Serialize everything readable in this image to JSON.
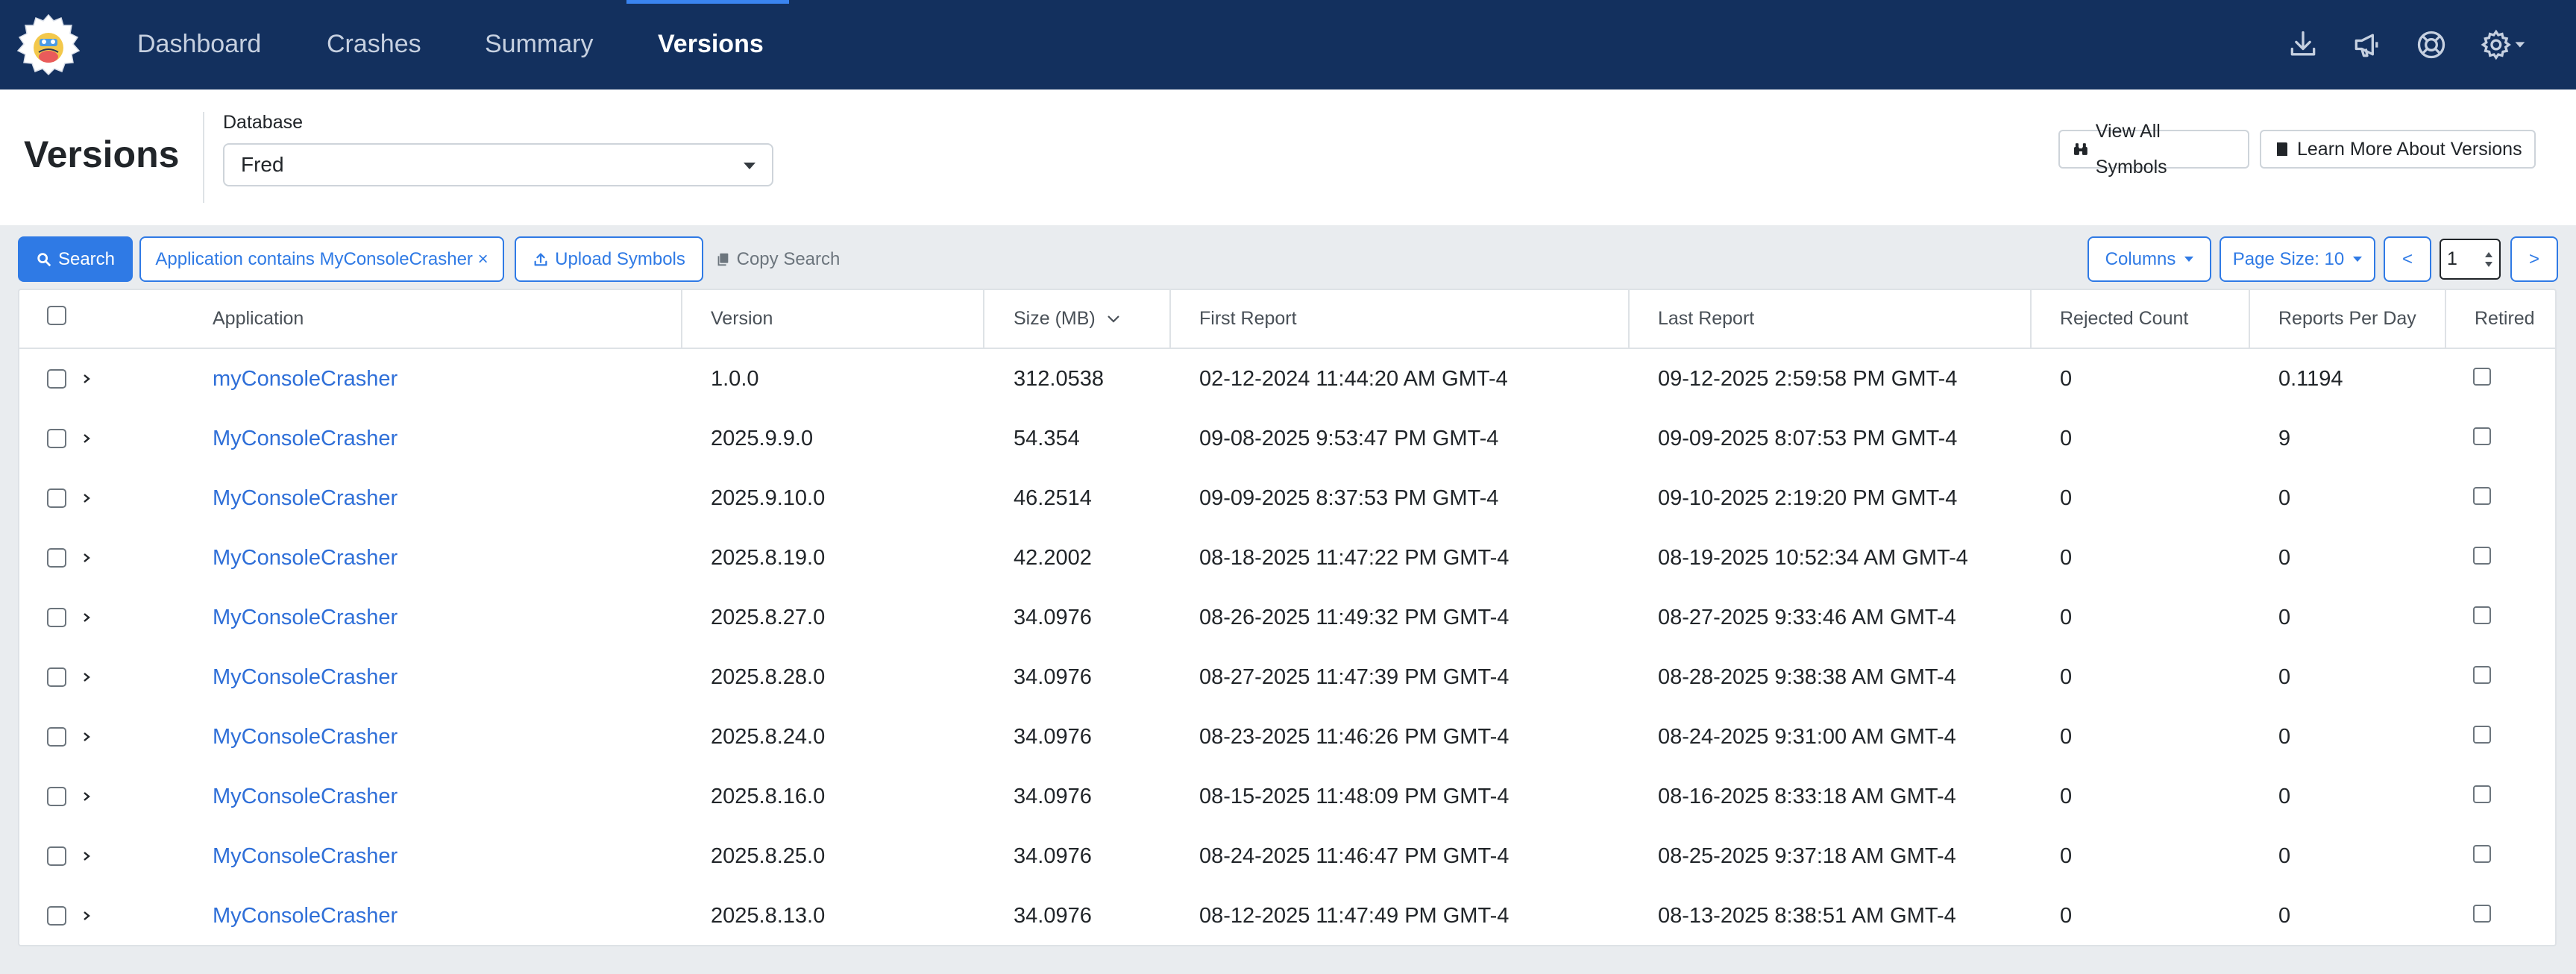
{
  "nav": {
    "items": [
      {
        "label": "Dashboard",
        "active": false
      },
      {
        "label": "Crashes",
        "active": false
      },
      {
        "label": "Summary",
        "active": false
      },
      {
        "label": "Versions",
        "active": true
      }
    ],
    "icons": [
      "download-icon",
      "megaphone-icon",
      "lifebuoy-icon",
      "gear-icon"
    ],
    "background": "#13305e",
    "accent": "#3a84f0"
  },
  "header": {
    "title": "Versions",
    "database_label": "Database",
    "database_value": "Fred",
    "view_symbols": "View All Symbols",
    "learn_more": "Learn More About Versions"
  },
  "toolbar": {
    "search": "Search",
    "filter": "Application contains MyConsoleCrasher ×",
    "upload": "Upload Symbols",
    "copy": "Copy Search",
    "columns": "Columns",
    "page_size": "Page Size: 10",
    "prev": "<",
    "page": "1",
    "next": ">"
  },
  "table": {
    "columns": [
      "Application",
      "Version",
      "Size (MB)",
      "First Report",
      "Last Report",
      "Rejected Count",
      "Reports Per Day",
      "Retired"
    ],
    "sorted_column": "Size (MB)",
    "rows": [
      {
        "app": "myConsoleCrasher",
        "version": "1.0.0",
        "size": "312.0538",
        "first": "02-12-2024 11:44:20 AM GMT-4",
        "last": "09-12-2025 2:59:58 PM GMT-4",
        "rejected": "0",
        "per_day": "0.1194"
      },
      {
        "app": "MyConsoleCrasher",
        "version": "2025.9.9.0",
        "size": "54.354",
        "first": "09-08-2025 9:53:47 PM GMT-4",
        "last": "09-09-2025 8:07:53 PM GMT-4",
        "rejected": "0",
        "per_day": "9"
      },
      {
        "app": "MyConsoleCrasher",
        "version": "2025.9.10.0",
        "size": "46.2514",
        "first": "09-09-2025 8:37:53 PM GMT-4",
        "last": "09-10-2025 2:19:20 PM GMT-4",
        "rejected": "0",
        "per_day": "0"
      },
      {
        "app": "MyConsoleCrasher",
        "version": "2025.8.19.0",
        "size": "42.2002",
        "first": "08-18-2025 11:47:22 PM GMT-4",
        "last": "08-19-2025 10:52:34 AM GMT-4",
        "rejected": "0",
        "per_day": "0"
      },
      {
        "app": "MyConsoleCrasher",
        "version": "2025.8.27.0",
        "size": "34.0976",
        "first": "08-26-2025 11:49:32 PM GMT-4",
        "last": "08-27-2025 9:33:46 AM GMT-4",
        "rejected": "0",
        "per_day": "0"
      },
      {
        "app": "MyConsoleCrasher",
        "version": "2025.8.28.0",
        "size": "34.0976",
        "first": "08-27-2025 11:47:39 PM GMT-4",
        "last": "08-28-2025 9:38:38 AM GMT-4",
        "rejected": "0",
        "per_day": "0"
      },
      {
        "app": "MyConsoleCrasher",
        "version": "2025.8.24.0",
        "size": "34.0976",
        "first": "08-23-2025 11:46:26 PM GMT-4",
        "last": "08-24-2025 9:31:00 AM GMT-4",
        "rejected": "0",
        "per_day": "0"
      },
      {
        "app": "MyConsoleCrasher",
        "version": "2025.8.16.0",
        "size": "34.0976",
        "first": "08-15-2025 11:48:09 PM GMT-4",
        "last": "08-16-2025 8:33:18 AM GMT-4",
        "rejected": "0",
        "per_day": "0"
      },
      {
        "app": "MyConsoleCrasher",
        "version": "2025.8.25.0",
        "size": "34.0976",
        "first": "08-24-2025 11:46:47 PM GMT-4",
        "last": "08-25-2025 9:37:18 AM GMT-4",
        "rejected": "0",
        "per_day": "0"
      },
      {
        "app": "MyConsoleCrasher",
        "version": "2025.8.13.0",
        "size": "34.0976",
        "first": "08-12-2025 11:47:49 PM GMT-4",
        "last": "08-13-2025 8:38:51 AM GMT-4",
        "rejected": "0",
        "per_day": "0"
      }
    ]
  }
}
